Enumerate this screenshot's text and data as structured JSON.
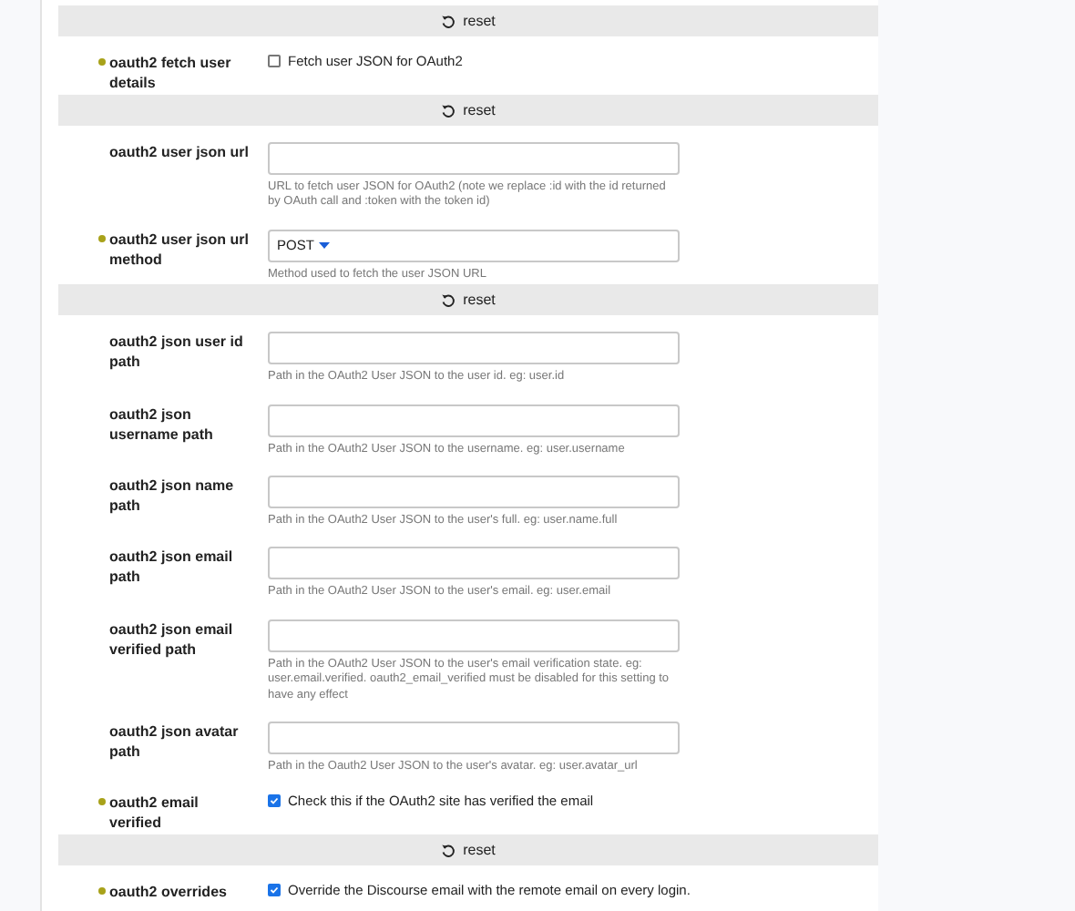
{
  "items": [
    {
      "kind": "reset",
      "label": "reset"
    },
    {
      "kind": "checkbox",
      "label": "oauth2 fetch user details",
      "modified": true,
      "text": "Fetch user JSON for OAuth2",
      "checked": false
    },
    {
      "kind": "reset",
      "label": "reset"
    },
    {
      "kind": "text",
      "label": "oauth2 user json url",
      "modified": false,
      "description": "URL to fetch user JSON for OAuth2 (note we replace :id with the id returned by OAuth call and :token with the token id)"
    },
    {
      "kind": "select",
      "label": "oauth2 user json url method",
      "modified": true,
      "value": "POST",
      "description": "Method used to fetch the user JSON URL"
    },
    {
      "kind": "reset",
      "label": "reset"
    },
    {
      "kind": "text",
      "label": "oauth2 json user id path",
      "modified": false,
      "description": "Path in the OAuth2 User JSON to the user id. eg: user.id"
    },
    {
      "kind": "text",
      "label": "oauth2 json username path",
      "modified": false,
      "description": "Path in the OAuth2 User JSON to the username. eg: user.username"
    },
    {
      "kind": "text",
      "label": "oauth2 json name path",
      "modified": false,
      "description": "Path in the OAuth2 User JSON to the user's full. eg: user.name.full"
    },
    {
      "kind": "text",
      "label": "oauth2 json email path",
      "modified": false,
      "description": "Path in the OAuth2 User JSON to the user's email. eg: user.email"
    },
    {
      "kind": "text",
      "label": "oauth2 json email verified path",
      "modified": false,
      "description": "Path in the OAuth2 User JSON to the user's email verification state. eg: user.email.verified. oauth2_email_verified must be disabled for this setting to have any effect"
    },
    {
      "kind": "text",
      "label": "oauth2 json avatar path",
      "modified": false,
      "description": "Path in the Oauth2 User JSON to the user's avatar. eg: user.avatar_url"
    },
    {
      "kind": "checkbox",
      "label": "oauth2 email verified",
      "modified": true,
      "text": "Check this if the OAuth2 site has verified the email",
      "checked": true
    },
    {
      "kind": "reset",
      "label": "reset"
    },
    {
      "kind": "checkbox",
      "label": "oauth2 overrides",
      "modified": true,
      "text": "Override the Discourse email with the remote email on every login.",
      "checked": true
    }
  ]
}
